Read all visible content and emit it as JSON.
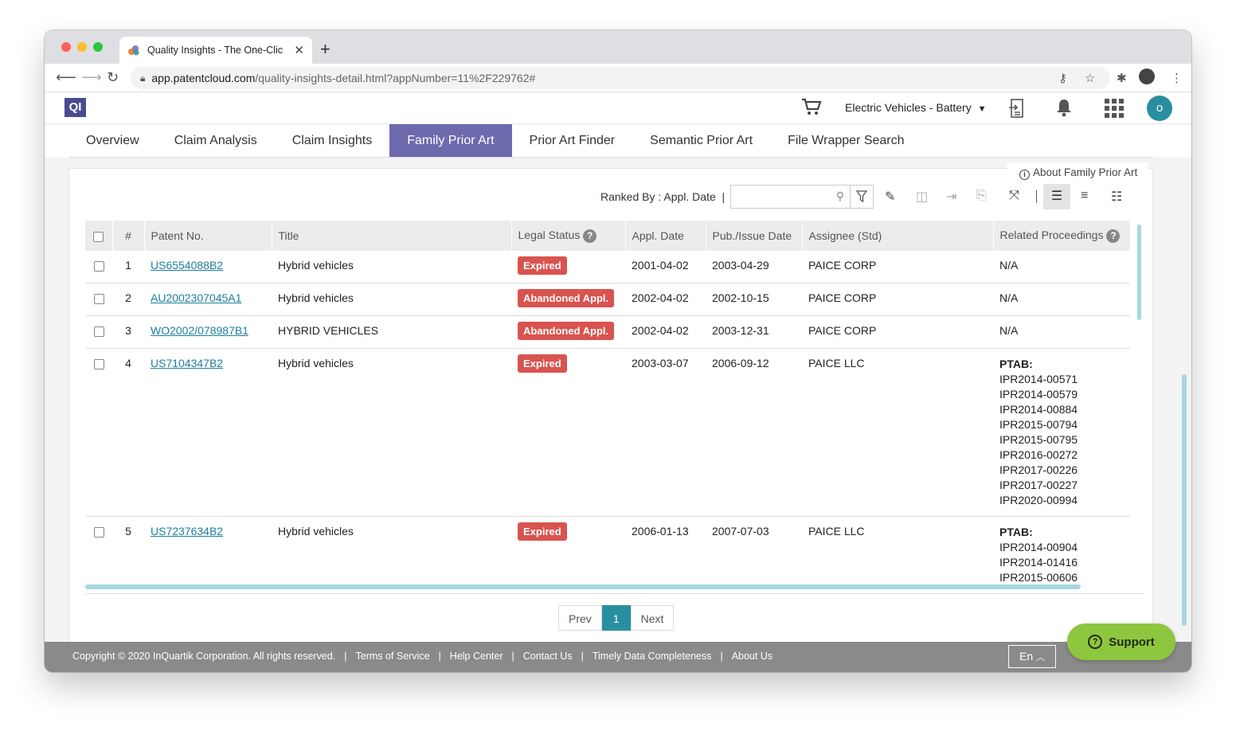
{
  "browser": {
    "tab_title": "Quality Insights - The One-Clic",
    "url_host": "app.patentcloud.com",
    "url_path": "/quality-insights-detail.html?appNumber=11%2F229762#"
  },
  "app": {
    "logo": "QI",
    "project": "Electric Vehicles - Battery",
    "avatar_initial": "o"
  },
  "tabs": [
    "Overview",
    "Claim Analysis",
    "Claim Insights",
    "Family Prior Art",
    "Prior Art Finder",
    "Semantic Prior Art",
    "File Wrapper Search"
  ],
  "active_tab": "Family Prior Art",
  "about_link": "About Family Prior Art",
  "toolbar": {
    "ranked_by": "Ranked By : Appl. Date",
    "search_placeholder": ""
  },
  "table": {
    "headers": {
      "num": "#",
      "patent": "Patent No.",
      "title": "Title",
      "status": "Legal Status",
      "appl_date": "Appl. Date",
      "pub_date": "Pub./Issue Date",
      "assignee": "Assignee (Std)",
      "proceedings": "Related Proceedings"
    },
    "rows": [
      {
        "num": "1",
        "patent": "US6554088B2",
        "title": "Hybrid vehicles",
        "status": "Expired",
        "appl_date": "2001-04-02",
        "pub_date": "2003-04-29",
        "assignee": "PAICE CORP",
        "proc_na": "N/A"
      },
      {
        "num": "2",
        "patent": "AU2002307045A1",
        "title": "Hybrid vehicles",
        "status": "Abandoned Appl.",
        "appl_date": "2002-04-02",
        "pub_date": "2002-10-15",
        "assignee": "PAICE CORP",
        "proc_na": "N/A"
      },
      {
        "num": "3",
        "patent": "WO2002/078987B1",
        "title": "HYBRID VEHICLES",
        "status": "Abandoned Appl.",
        "appl_date": "2002-04-02",
        "pub_date": "2003-12-31",
        "assignee": "PAICE CORP",
        "proc_na": "N/A"
      },
      {
        "num": "4",
        "patent": "US7104347B2",
        "title": "Hybrid vehicles",
        "status": "Expired",
        "appl_date": "2003-03-07",
        "pub_date": "2006-09-12",
        "assignee": "PAICE LLC",
        "proc_label": "PTAB:",
        "proc_items": [
          "IPR2014-00571",
          "IPR2014-00579",
          "IPR2014-00884",
          "IPR2015-00794",
          "IPR2015-00795",
          "IPR2016-00272",
          "IPR2017-00226",
          "IPR2017-00227",
          "IPR2020-00994"
        ]
      },
      {
        "num": "5",
        "patent": "US7237634B2",
        "title": "Hybrid vehicles",
        "status": "Expired",
        "appl_date": "2006-01-13",
        "pub_date": "2007-07-03",
        "assignee": "PAICE LLC",
        "proc_label": "PTAB:",
        "proc_items": [
          "IPR2014-00904",
          "IPR2014-01416",
          "IPR2015-00606"
        ]
      }
    ]
  },
  "pagination": {
    "prev": "Prev",
    "current": "1",
    "next": "Next"
  },
  "footer": {
    "copyright": "Copyright © 2020 InQuartik Corporation. All rights reserved.",
    "links": [
      "Terms of Service",
      "Help Center",
      "Contact Us",
      "Timely Data Completeness",
      "About Us"
    ],
    "lang": "En"
  },
  "support": "Support",
  "colors": {
    "accent": "#6d6aad",
    "teal": "#2a8ea1",
    "expired": "#d9534f",
    "support": "#8dc63f",
    "footer": "#8a8a8a"
  }
}
